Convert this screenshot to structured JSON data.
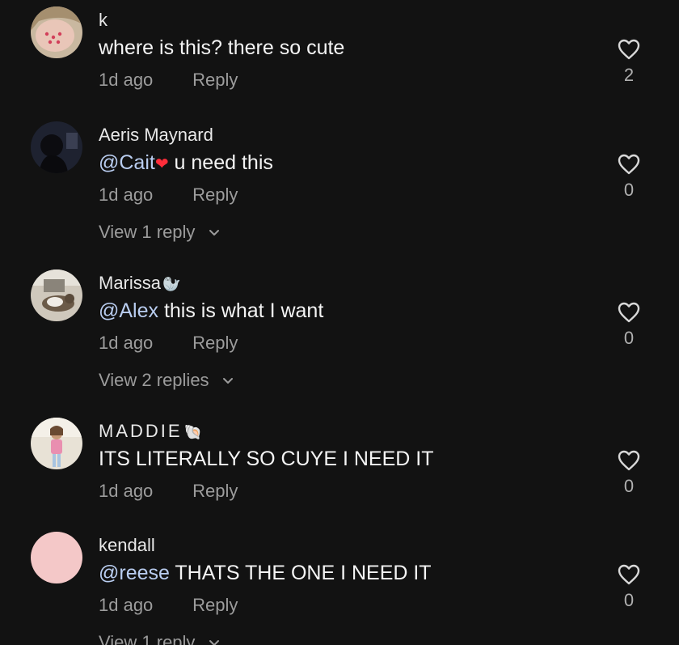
{
  "comments": [
    {
      "username": "k",
      "username_emoji": "",
      "mention": "",
      "mention_emoji": "",
      "text": "where is this? there so cute",
      "time": "1d ago",
      "reply_label": "Reply",
      "likes": "2",
      "view_replies": "",
      "avatar": "photo-face"
    },
    {
      "username": "Aeris Maynard",
      "username_emoji": "",
      "mention": "@Cait",
      "mention_emoji": "❤",
      "text": " u need this",
      "time": "1d ago",
      "reply_label": "Reply",
      "likes": "0",
      "view_replies": "View 1 reply",
      "avatar": "photo-dark"
    },
    {
      "username": "Marissa",
      "username_emoji": "🦭",
      "mention": "@Alex",
      "mention_emoji": "",
      "text": " this is what I want",
      "time": "1d ago",
      "reply_label": "Reply",
      "likes": "0",
      "view_replies": "View 2 replies",
      "avatar": "photo-cat"
    },
    {
      "username": "MADDIE",
      "username_emoji": "🐚",
      "mention": "",
      "mention_emoji": "",
      "text": "ITS LITERALLY SO CUYE I NEED IT",
      "time": "1d ago",
      "reply_label": "Reply",
      "likes": "0",
      "view_replies": "",
      "avatar": "photo-girl"
    },
    {
      "username": "kendall",
      "username_emoji": "",
      "mention": "@reese",
      "mention_emoji": "",
      "text": " THATS THE ONE I NEED IT",
      "time": "1d ago",
      "reply_label": "Reply",
      "likes": "0",
      "view_replies": "View 1 reply",
      "avatar": "plain-pink"
    }
  ],
  "colors": {
    "background": "#121212",
    "mention": "#b9cdf0",
    "muted": "#9c9c9c",
    "avatar_pink": "#f4c8c8"
  }
}
